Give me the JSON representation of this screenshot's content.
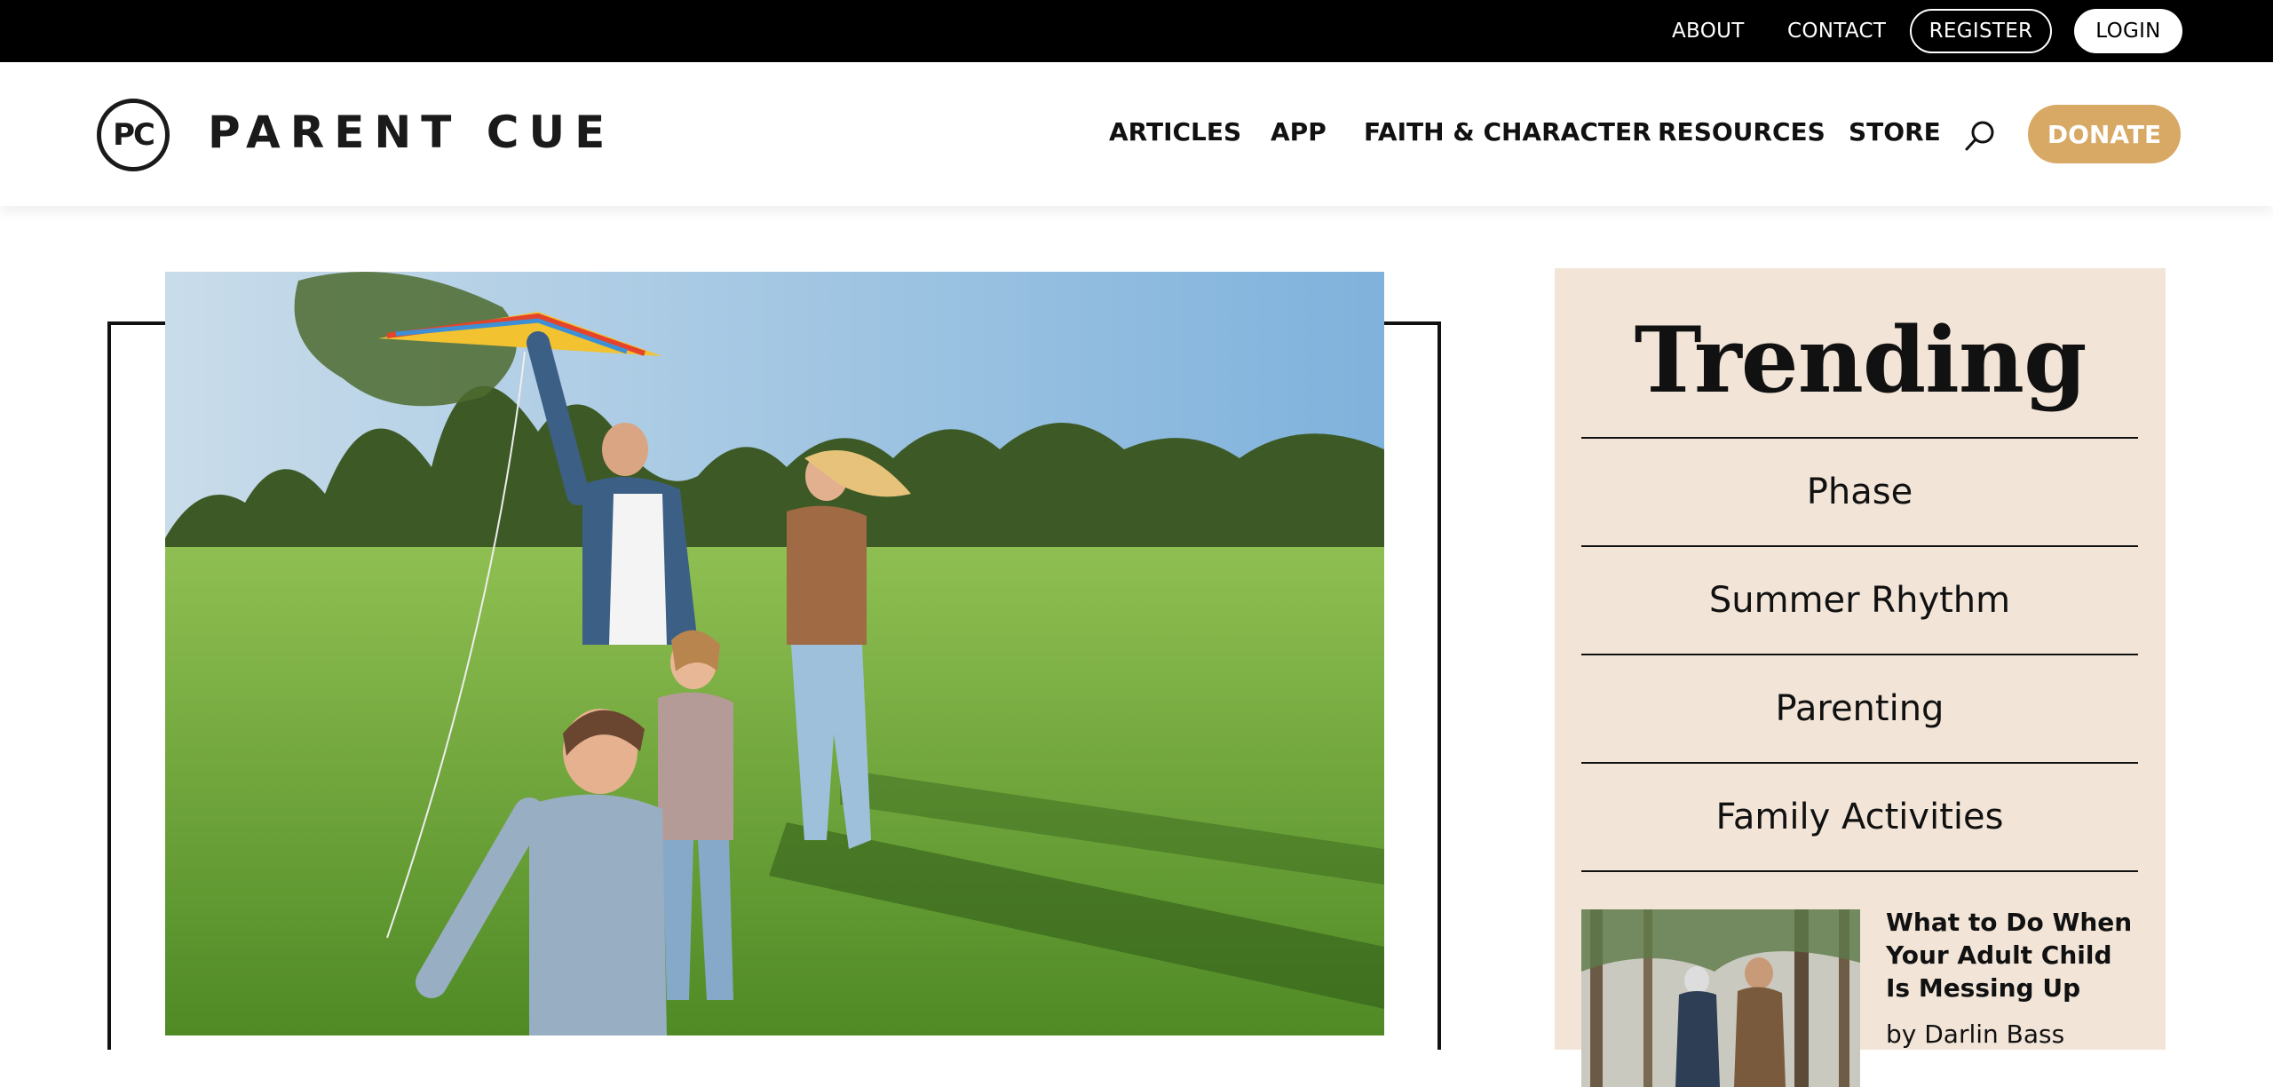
{
  "topbar": {
    "about": "ABOUT",
    "contact": "CONTACT",
    "register": "REGISTER",
    "login": "LOGIN"
  },
  "header": {
    "logo_mark": "PC",
    "logo_text": "PARENT CUE",
    "nav": [
      "ARTICLES",
      "APP",
      "FAITH & CHARACTER",
      "RESOURCES",
      "STORE"
    ],
    "search_icon": "search-icon",
    "donate": "DONATE",
    "donate_color": "#d7a965"
  },
  "sidebar": {
    "title": "Trending",
    "background": "#f2e5d8",
    "topics": [
      "Phase",
      "Summer Rhythm",
      "Parenting",
      "Family Activities"
    ],
    "card": {
      "title": "What to Do When Your Adult Child Is Messing Up",
      "author": "by Darlin Bass"
    }
  }
}
